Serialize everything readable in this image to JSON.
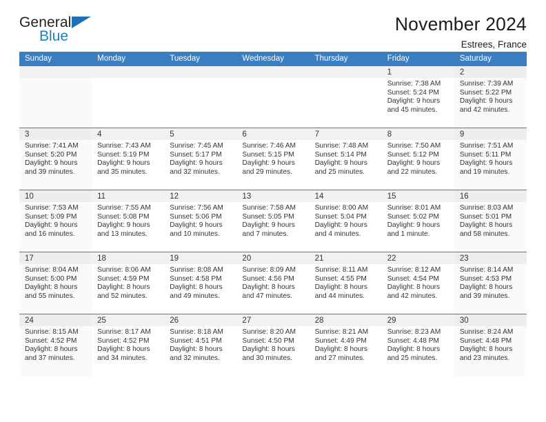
{
  "brand": {
    "name_part1": "General",
    "name_part2": "Blue",
    "triangle_color": "#1f6fb8",
    "blue_text_color": "#1b7fc4"
  },
  "header": {
    "title": "November 2024",
    "location": "Estrees, France"
  },
  "theme": {
    "header_blue": "#3a7dc0",
    "daynum_band": "#f1f1f1",
    "weekend_tint": "#fafafa"
  },
  "weekdays": [
    "Sunday",
    "Monday",
    "Tuesday",
    "Wednesday",
    "Thursday",
    "Friday",
    "Saturday"
  ],
  "labels": {
    "sunrise_prefix": "Sunrise:",
    "sunset_prefix": "Sunset:",
    "daylight_prefix": "Daylight:"
  },
  "weeks": [
    [
      {
        "day": "",
        "empty": true
      },
      {
        "day": "",
        "empty": true
      },
      {
        "day": "",
        "empty": true
      },
      {
        "day": "",
        "empty": true
      },
      {
        "day": "",
        "empty": true
      },
      {
        "day": "1",
        "sunrise": "Sunrise: 7:38 AM",
        "sunset": "Sunset: 5:24 PM",
        "daylight_line1": "Daylight: 9 hours",
        "daylight_line2": "and 45 minutes."
      },
      {
        "day": "2",
        "sunrise": "Sunrise: 7:39 AM",
        "sunset": "Sunset: 5:22 PM",
        "daylight_line1": "Daylight: 9 hours",
        "daylight_line2": "and 42 minutes."
      }
    ],
    [
      {
        "day": "3",
        "sunrise": "Sunrise: 7:41 AM",
        "sunset": "Sunset: 5:20 PM",
        "daylight_line1": "Daylight: 9 hours",
        "daylight_line2": "and 39 minutes."
      },
      {
        "day": "4",
        "sunrise": "Sunrise: 7:43 AM",
        "sunset": "Sunset: 5:19 PM",
        "daylight_line1": "Daylight: 9 hours",
        "daylight_line2": "and 35 minutes."
      },
      {
        "day": "5",
        "sunrise": "Sunrise: 7:45 AM",
        "sunset": "Sunset: 5:17 PM",
        "daylight_line1": "Daylight: 9 hours",
        "daylight_line2": "and 32 minutes."
      },
      {
        "day": "6",
        "sunrise": "Sunrise: 7:46 AM",
        "sunset": "Sunset: 5:15 PM",
        "daylight_line1": "Daylight: 9 hours",
        "daylight_line2": "and 29 minutes."
      },
      {
        "day": "7",
        "sunrise": "Sunrise: 7:48 AM",
        "sunset": "Sunset: 5:14 PM",
        "daylight_line1": "Daylight: 9 hours",
        "daylight_line2": "and 25 minutes."
      },
      {
        "day": "8",
        "sunrise": "Sunrise: 7:50 AM",
        "sunset": "Sunset: 5:12 PM",
        "daylight_line1": "Daylight: 9 hours",
        "daylight_line2": "and 22 minutes."
      },
      {
        "day": "9",
        "sunrise": "Sunrise: 7:51 AM",
        "sunset": "Sunset: 5:11 PM",
        "daylight_line1": "Daylight: 9 hours",
        "daylight_line2": "and 19 minutes."
      }
    ],
    [
      {
        "day": "10",
        "sunrise": "Sunrise: 7:53 AM",
        "sunset": "Sunset: 5:09 PM",
        "daylight_line1": "Daylight: 9 hours",
        "daylight_line2": "and 16 minutes."
      },
      {
        "day": "11",
        "sunrise": "Sunrise: 7:55 AM",
        "sunset": "Sunset: 5:08 PM",
        "daylight_line1": "Daylight: 9 hours",
        "daylight_line2": "and 13 minutes."
      },
      {
        "day": "12",
        "sunrise": "Sunrise: 7:56 AM",
        "sunset": "Sunset: 5:06 PM",
        "daylight_line1": "Daylight: 9 hours",
        "daylight_line2": "and 10 minutes."
      },
      {
        "day": "13",
        "sunrise": "Sunrise: 7:58 AM",
        "sunset": "Sunset: 5:05 PM",
        "daylight_line1": "Daylight: 9 hours",
        "daylight_line2": "and 7 minutes."
      },
      {
        "day": "14",
        "sunrise": "Sunrise: 8:00 AM",
        "sunset": "Sunset: 5:04 PM",
        "daylight_line1": "Daylight: 9 hours",
        "daylight_line2": "and 4 minutes."
      },
      {
        "day": "15",
        "sunrise": "Sunrise: 8:01 AM",
        "sunset": "Sunset: 5:02 PM",
        "daylight_line1": "Daylight: 9 hours",
        "daylight_line2": "and 1 minute."
      },
      {
        "day": "16",
        "sunrise": "Sunrise: 8:03 AM",
        "sunset": "Sunset: 5:01 PM",
        "daylight_line1": "Daylight: 8 hours",
        "daylight_line2": "and 58 minutes."
      }
    ],
    [
      {
        "day": "17",
        "sunrise": "Sunrise: 8:04 AM",
        "sunset": "Sunset: 5:00 PM",
        "daylight_line1": "Daylight: 8 hours",
        "daylight_line2": "and 55 minutes."
      },
      {
        "day": "18",
        "sunrise": "Sunrise: 8:06 AM",
        "sunset": "Sunset: 4:59 PM",
        "daylight_line1": "Daylight: 8 hours",
        "daylight_line2": "and 52 minutes."
      },
      {
        "day": "19",
        "sunrise": "Sunrise: 8:08 AM",
        "sunset": "Sunset: 4:58 PM",
        "daylight_line1": "Daylight: 8 hours",
        "daylight_line2": "and 49 minutes."
      },
      {
        "day": "20",
        "sunrise": "Sunrise: 8:09 AM",
        "sunset": "Sunset: 4:56 PM",
        "daylight_line1": "Daylight: 8 hours",
        "daylight_line2": "and 47 minutes."
      },
      {
        "day": "21",
        "sunrise": "Sunrise: 8:11 AM",
        "sunset": "Sunset: 4:55 PM",
        "daylight_line1": "Daylight: 8 hours",
        "daylight_line2": "and 44 minutes."
      },
      {
        "day": "22",
        "sunrise": "Sunrise: 8:12 AM",
        "sunset": "Sunset: 4:54 PM",
        "daylight_line1": "Daylight: 8 hours",
        "daylight_line2": "and 42 minutes."
      },
      {
        "day": "23",
        "sunrise": "Sunrise: 8:14 AM",
        "sunset": "Sunset: 4:53 PM",
        "daylight_line1": "Daylight: 8 hours",
        "daylight_line2": "and 39 minutes."
      }
    ],
    [
      {
        "day": "24",
        "sunrise": "Sunrise: 8:15 AM",
        "sunset": "Sunset: 4:52 PM",
        "daylight_line1": "Daylight: 8 hours",
        "daylight_line2": "and 37 minutes."
      },
      {
        "day": "25",
        "sunrise": "Sunrise: 8:17 AM",
        "sunset": "Sunset: 4:52 PM",
        "daylight_line1": "Daylight: 8 hours",
        "daylight_line2": "and 34 minutes."
      },
      {
        "day": "26",
        "sunrise": "Sunrise: 8:18 AM",
        "sunset": "Sunset: 4:51 PM",
        "daylight_line1": "Daylight: 8 hours",
        "daylight_line2": "and 32 minutes."
      },
      {
        "day": "27",
        "sunrise": "Sunrise: 8:20 AM",
        "sunset": "Sunset: 4:50 PM",
        "daylight_line1": "Daylight: 8 hours",
        "daylight_line2": "and 30 minutes."
      },
      {
        "day": "28",
        "sunrise": "Sunrise: 8:21 AM",
        "sunset": "Sunset: 4:49 PM",
        "daylight_line1": "Daylight: 8 hours",
        "daylight_line2": "and 27 minutes."
      },
      {
        "day": "29",
        "sunrise": "Sunrise: 8:23 AM",
        "sunset": "Sunset: 4:48 PM",
        "daylight_line1": "Daylight: 8 hours",
        "daylight_line2": "and 25 minutes."
      },
      {
        "day": "30",
        "sunrise": "Sunrise: 8:24 AM",
        "sunset": "Sunset: 4:48 PM",
        "daylight_line1": "Daylight: 8 hours",
        "daylight_line2": "and 23 minutes."
      }
    ]
  ]
}
